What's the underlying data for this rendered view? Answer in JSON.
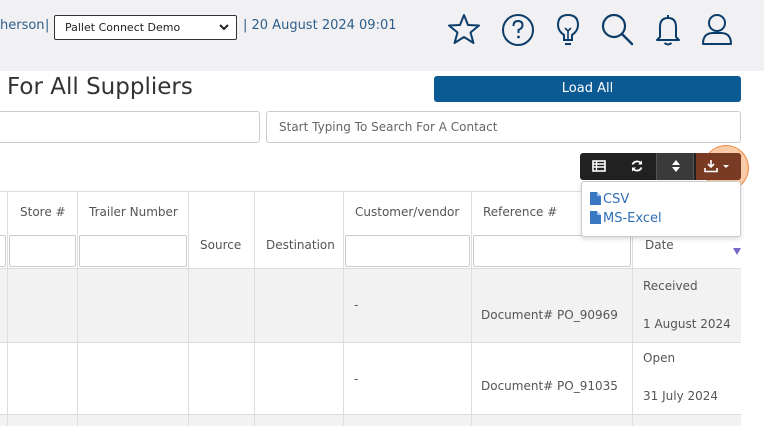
{
  "header": {
    "user_name": "herson",
    "separator": "|",
    "company_select": "Pallet Connect Demo",
    "datetime": "| 20 August 2024 09:01",
    "icons": [
      "star-icon",
      "help-icon",
      "lightbulb-icon",
      "search-icon",
      "bell-icon",
      "user-icon"
    ]
  },
  "page": {
    "title": "For All Suppliers",
    "load_all_label": "Load All",
    "contact_search_placeholder": "Start Typing To Search For A Contact"
  },
  "toolbar": {
    "buttons": [
      "columns-icon",
      "refresh-icon",
      "sort-icon",
      "download-icon"
    ]
  },
  "export_menu": {
    "items": [
      "CSV",
      "MS-Excel"
    ]
  },
  "table": {
    "headers": {
      "store": "Store #",
      "trailer": "Trailer Number",
      "source": "Source",
      "destination": "Destination",
      "customer_vendor": "Customer/vendor",
      "reference": "Reference #",
      "date": "Date"
    },
    "rows": [
      {
        "customer_vendor": "-",
        "reference": "Document# PO_90969",
        "status": "Received",
        "date": "1 August 2024"
      },
      {
        "customer_vendor": "-",
        "reference": "Document# PO_91035",
        "status": "Open",
        "date": "31 July 2024"
      }
    ]
  },
  "colors": {
    "load_all_bg": "#0c5a94",
    "toolbar_bg": "#212121",
    "export_bg": "#7a3b24",
    "link": "#2d6fb7",
    "highlight": "#f58c3c"
  }
}
